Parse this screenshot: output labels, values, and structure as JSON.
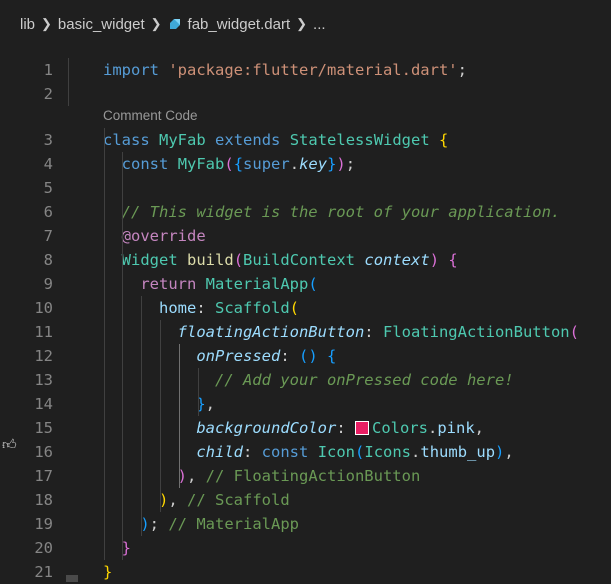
{
  "breadcrumb": {
    "items": [
      "lib",
      "basic_widget",
      "fab_widget.dart",
      "..."
    ]
  },
  "codelens": "Comment Code",
  "lines": [
    {
      "n": "1",
      "tokens": [
        [
          "kw2",
          "import"
        ],
        [
          "punc",
          " "
        ],
        [
          "str",
          "'package:flutter/material.dart'"
        ],
        [
          "punc",
          ";"
        ]
      ]
    },
    {
      "n": "2",
      "tokens": []
    },
    {
      "n": "3",
      "tokens": [
        [
          "kw2",
          "class"
        ],
        [
          "punc",
          " "
        ],
        [
          "cls",
          "MyFab"
        ],
        [
          "punc",
          " "
        ],
        [
          "kw2",
          "extends"
        ],
        [
          "punc",
          " "
        ],
        [
          "cls",
          "StatelessWidget"
        ],
        [
          "punc",
          " "
        ],
        [
          "br1",
          "{"
        ]
      ]
    },
    {
      "n": "4",
      "tokens": [
        [
          "punc",
          "  "
        ],
        [
          "kw2",
          "const"
        ],
        [
          "punc",
          " "
        ],
        [
          "cls",
          "MyFab"
        ],
        [
          "br2",
          "("
        ],
        [
          "br3",
          "{"
        ],
        [
          "kw2",
          "super"
        ],
        [
          "punc",
          "."
        ],
        [
          "paramit",
          "key"
        ],
        [
          "br3",
          "}"
        ],
        [
          "br2",
          ")"
        ],
        [
          "punc",
          ";"
        ]
      ]
    },
    {
      "n": "5",
      "tokens": []
    },
    {
      "n": "6",
      "tokens": [
        [
          "punc",
          "  "
        ],
        [
          "cmt",
          "// This widget is the root of your application."
        ]
      ]
    },
    {
      "n": "7",
      "tokens": [
        [
          "punc",
          "  "
        ],
        [
          "kw",
          "@override"
        ]
      ]
    },
    {
      "n": "8",
      "tokens": [
        [
          "punc",
          "  "
        ],
        [
          "cls",
          "Widget"
        ],
        [
          "punc",
          " "
        ],
        [
          "fn",
          "build"
        ],
        [
          "br2",
          "("
        ],
        [
          "cls",
          "BuildContext"
        ],
        [
          "punc",
          " "
        ],
        [
          "paramit",
          "context"
        ],
        [
          "br2",
          ")"
        ],
        [
          "punc",
          " "
        ],
        [
          "br2",
          "{"
        ]
      ]
    },
    {
      "n": "9",
      "tokens": [
        [
          "punc",
          "    "
        ],
        [
          "kw",
          "return"
        ],
        [
          "punc",
          " "
        ],
        [
          "cls",
          "MaterialApp"
        ],
        [
          "br3",
          "("
        ]
      ]
    },
    {
      "n": "10",
      "tokens": [
        [
          "punc",
          "      "
        ],
        [
          "param",
          "home"
        ],
        [
          "punc",
          ": "
        ],
        [
          "cls",
          "Scaffold"
        ],
        [
          "br1",
          "("
        ]
      ]
    },
    {
      "n": "11",
      "tokens": [
        [
          "punc",
          "        "
        ],
        [
          "paramit",
          "floatingActionButton"
        ],
        [
          "punc",
          ": "
        ],
        [
          "cls",
          "FloatingActionButton"
        ],
        [
          "br2",
          "("
        ]
      ]
    },
    {
      "n": "12",
      "tokens": [
        [
          "punc",
          "          "
        ],
        [
          "paramit",
          "onPressed"
        ],
        [
          "punc",
          ": "
        ],
        [
          "br3",
          "()"
        ],
        [
          "punc",
          " "
        ],
        [
          "br3",
          "{"
        ]
      ]
    },
    {
      "n": "13",
      "tokens": [
        [
          "punc",
          "            "
        ],
        [
          "cmt",
          "// Add your onPressed code here!"
        ]
      ]
    },
    {
      "n": "14",
      "tokens": [
        [
          "punc",
          "          "
        ],
        [
          "br3",
          "}"
        ],
        [
          "punc",
          ","
        ]
      ]
    },
    {
      "n": "15",
      "tokens": [
        [
          "punc",
          "          "
        ],
        [
          "paramit",
          "backgroundColor"
        ],
        [
          "punc",
          ": "
        ],
        [
          "swatch",
          ""
        ],
        [
          "cls",
          "Colors"
        ],
        [
          "punc",
          "."
        ],
        [
          "param",
          "pink"
        ],
        [
          "punc",
          ","
        ]
      ]
    },
    {
      "n": "16",
      "tokens": [
        [
          "punc",
          "          "
        ],
        [
          "paramit",
          "child"
        ],
        [
          "punc",
          ": "
        ],
        [
          "kw2",
          "const"
        ],
        [
          "punc",
          " "
        ],
        [
          "cls",
          "Icon"
        ],
        [
          "br3",
          "("
        ],
        [
          "cls",
          "Icons"
        ],
        [
          "punc",
          "."
        ],
        [
          "param",
          "thumb_up"
        ],
        [
          "br3",
          ")"
        ],
        [
          "punc",
          ","
        ]
      ]
    },
    {
      "n": "17",
      "tokens": [
        [
          "punc",
          "        "
        ],
        [
          "br2",
          ")"
        ],
        [
          "punc",
          ", "
        ],
        [
          "cmt2",
          "// FloatingActionButton"
        ]
      ]
    },
    {
      "n": "18",
      "tokens": [
        [
          "punc",
          "      "
        ],
        [
          "br1",
          ")"
        ],
        [
          "punc",
          ", "
        ],
        [
          "cmt2",
          "// Scaffold"
        ]
      ]
    },
    {
      "n": "19",
      "tokens": [
        [
          "punc",
          "    "
        ],
        [
          "br3",
          ")"
        ],
        [
          "punc",
          "; "
        ],
        [
          "cmt2",
          "// MaterialApp"
        ]
      ]
    },
    {
      "n": "20",
      "tokens": [
        [
          "punc",
          "  "
        ],
        [
          "br2",
          "}"
        ]
      ]
    },
    {
      "n": "21",
      "tokens": [
        [
          "br1",
          "}"
        ]
      ]
    }
  ],
  "colors": {
    "background": "#1f1f1f",
    "swatch_pink": "#e91e63"
  },
  "icons": {
    "file": "dart-file-icon",
    "gutter": "thumb-up-icon"
  }
}
